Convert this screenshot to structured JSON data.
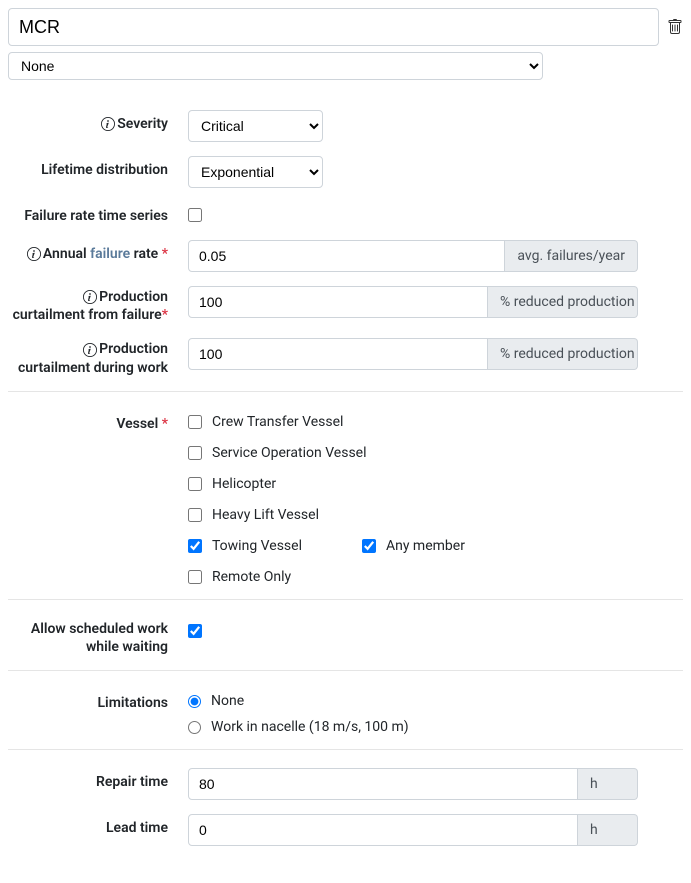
{
  "header": {
    "name_value": "MCR"
  },
  "subselect": {
    "value": "None"
  },
  "severity": {
    "label": "Severity",
    "value": "Critical"
  },
  "lifetime_distribution": {
    "label": "Lifetime distribution",
    "value": "Exponential"
  },
  "failure_rate_time_series": {
    "label": "Failure rate time series",
    "checked": false
  },
  "annual_failure_rate": {
    "label_prefix": "Annual ",
    "label_link": "failure",
    "label_suffix": " rate",
    "value": "0.05",
    "unit": "avg. failures/year"
  },
  "curtailment_failure": {
    "label": "Production curtailment from failure",
    "value": "100",
    "unit": "% reduced production"
  },
  "curtailment_work": {
    "label": "Production curtailment during work",
    "value": "100",
    "unit": "% reduced production"
  },
  "vessel": {
    "label": "Vessel",
    "options": {
      "crew_transfer": {
        "label": "Crew Transfer Vessel",
        "checked": false
      },
      "service_op": {
        "label": "Service Operation Vessel",
        "checked": false
      },
      "helicopter": {
        "label": "Helicopter",
        "checked": false
      },
      "heavy_lift": {
        "label": "Heavy Lift Vessel",
        "checked": false
      },
      "towing": {
        "label": "Towing Vessel",
        "checked": true
      },
      "any_member": {
        "label": "Any member",
        "checked": true
      },
      "remote_only": {
        "label": "Remote Only",
        "checked": false
      }
    }
  },
  "allow_scheduled": {
    "label": "Allow scheduled work while waiting",
    "checked": true
  },
  "limitations": {
    "label": "Limitations",
    "options": {
      "none": {
        "label": "None",
        "selected": true
      },
      "nacelle": {
        "label": "Work in nacelle (18 m/s, 100 m)",
        "selected": false
      }
    }
  },
  "repair_time": {
    "label": "Repair time",
    "value": "80",
    "unit": "h"
  },
  "lead_time": {
    "label": "Lead time",
    "value": "0",
    "unit": "h"
  }
}
